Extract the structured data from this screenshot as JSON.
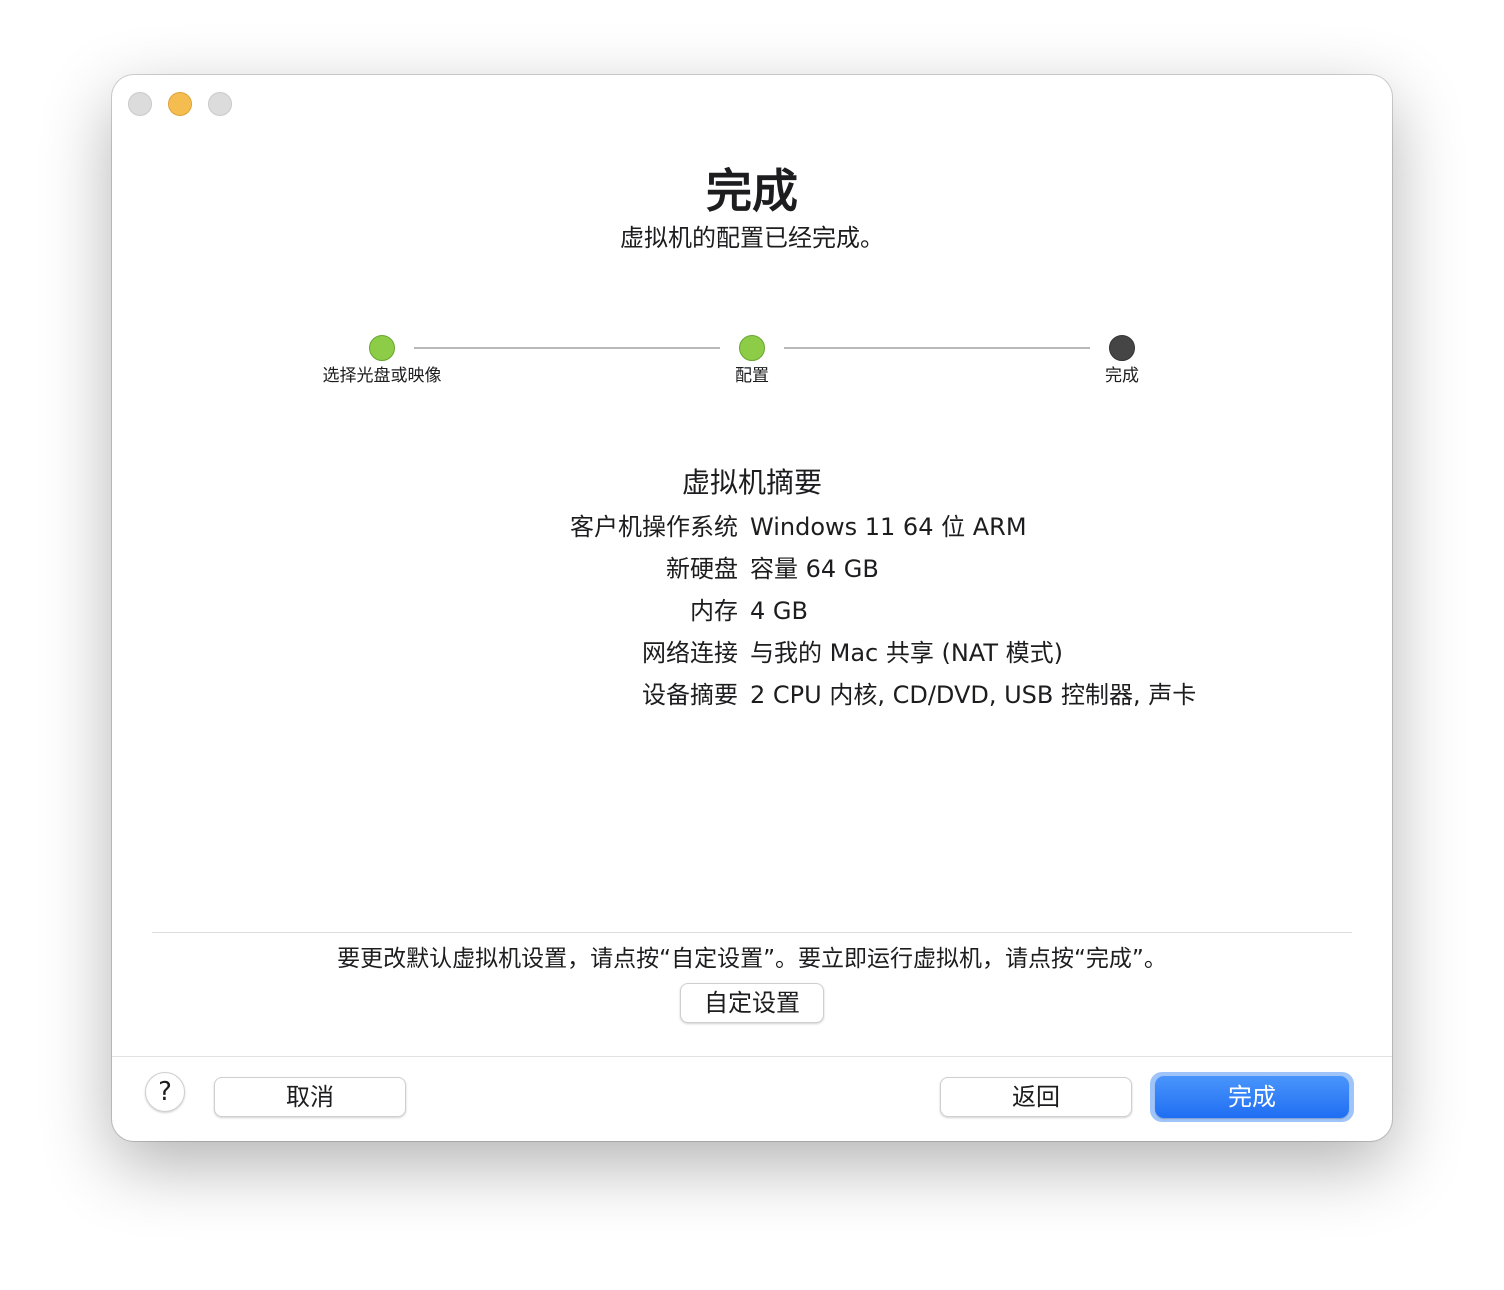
{
  "window": {
    "title": "完成",
    "subtitle": "虚拟机的配置已经完成。"
  },
  "steps": [
    {
      "label": "选择光盘或映像",
      "state": "done"
    },
    {
      "label": "配置",
      "state": "done"
    },
    {
      "label": "完成",
      "state": "current"
    }
  ],
  "colors": {
    "step_done": "#8ccc46",
    "step_current": "#454545",
    "primary_button": "#2c7cf6"
  },
  "summary": {
    "title": "虚拟机摘要",
    "rows": [
      {
        "key": "客户机操作系统",
        "value": "Windows 11 64 位 ARM"
      },
      {
        "key": "新硬盘",
        "value": "容量 64 GB"
      },
      {
        "key": "内存",
        "value": "4 GB"
      },
      {
        "key": "网络连接",
        "value": "与我的 Mac 共享 (NAT 模式)"
      },
      {
        "key": "设备摘要",
        "value": "2 CPU 内核, CD/DVD, USB 控制器, 声卡"
      }
    ]
  },
  "hint": "要更改默认虚拟机设置，请点按“自定设置”。要立即运行虚拟机，请点按“完成”。",
  "buttons": {
    "customize": "自定设置",
    "help": "?",
    "cancel": "取消",
    "back": "返回",
    "finish": "完成"
  }
}
